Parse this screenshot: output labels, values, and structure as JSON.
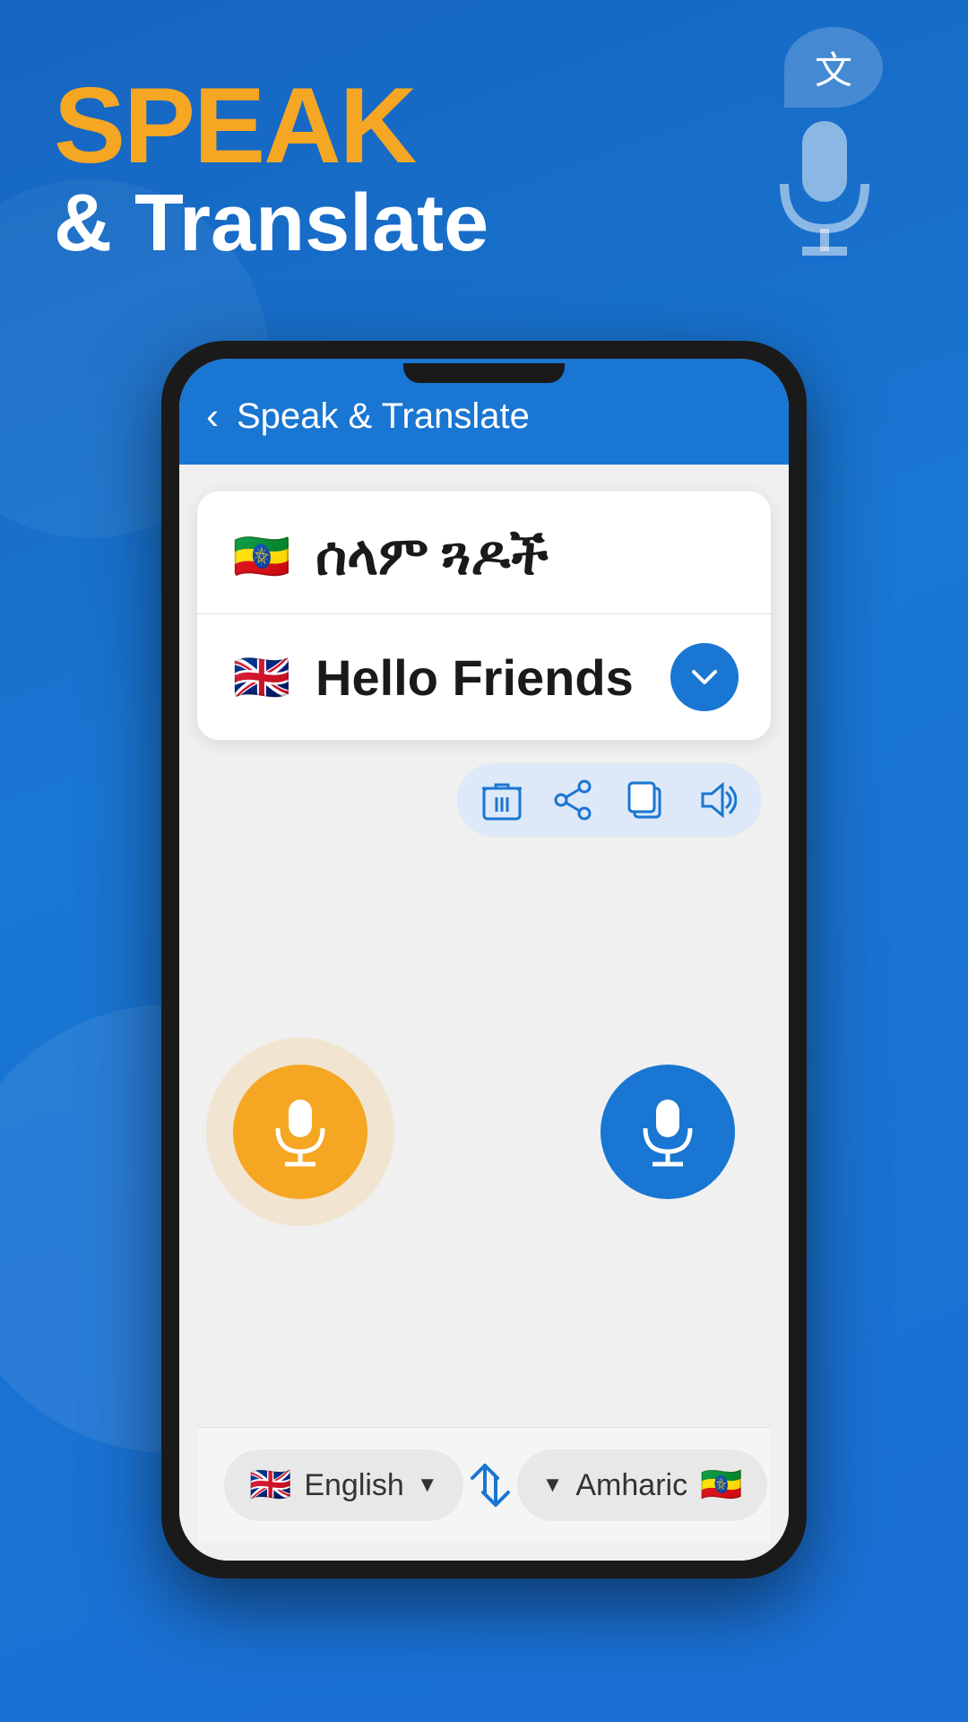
{
  "app": {
    "background_color": "#1976d2",
    "accent_color": "#f5a623"
  },
  "header": {
    "speak_label": "SPEAK",
    "translate_label": "& Translate",
    "translate_bubble_icon": "文",
    "app_bar_title": "Speak & Translate",
    "back_button_label": "‹"
  },
  "translation_card": {
    "source_flag": "🇪🇹",
    "source_text": "ሰላም ጓዶች",
    "target_flag": "🇬🇧",
    "target_text": "Hello Friends",
    "expand_icon": "⌄"
  },
  "action_buttons": {
    "delete_icon": "🗑",
    "share_icon": "⇗",
    "copy_icon": "⧉",
    "audio_icon": "🔊"
  },
  "mic_buttons": {
    "left_color": "#f5a623",
    "right_color": "#1976d2"
  },
  "language_bar": {
    "source_language": "English",
    "source_flag": "🇬🇧",
    "target_language": "Amharic",
    "target_flag": "🇪🇹",
    "swap_icon": "↺"
  }
}
